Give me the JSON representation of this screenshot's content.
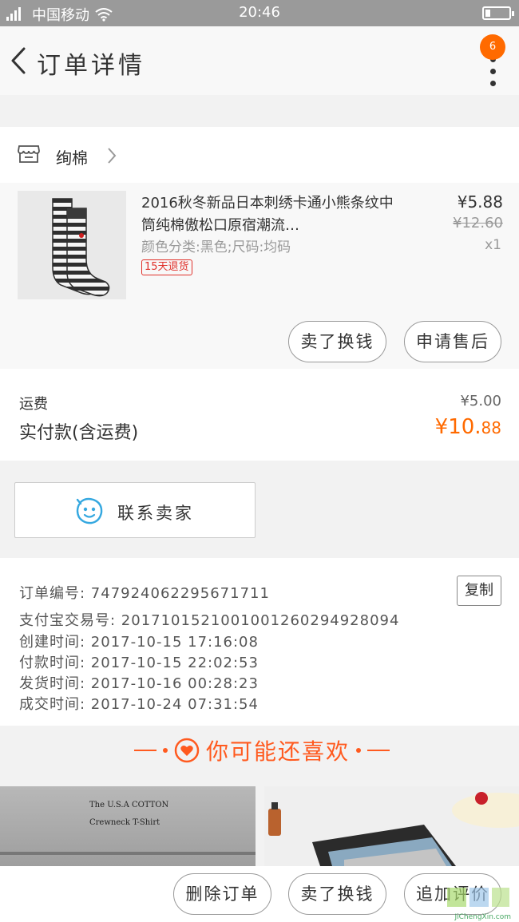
{
  "status_bar": {
    "carrier": "中国移动",
    "time": "20:46"
  },
  "nav": {
    "title": "订单详情",
    "badge_count": "6"
  },
  "shop": {
    "name": "绚棉"
  },
  "item": {
    "title": "2016秋冬新品日本刺绣卡通小熊条纹中筒纯棉傲松口原宿潮流…",
    "sku": "颜色分类:黑色;尺码:均码",
    "tag": "15天退货",
    "price": "¥5.88",
    "original_price": "¥12.60",
    "quantity": "x1",
    "actions": {
      "sell": "卖了换钱",
      "after_sale": "申请售后"
    }
  },
  "fees": {
    "shipping_label": "运费",
    "shipping_value": "¥5.00",
    "paid_label": "实付款(含运费)",
    "paid_symbol": "¥",
    "paid_int": "10.",
    "paid_dec": "88"
  },
  "contact": {
    "label": "联系卖家"
  },
  "order_info": {
    "order_no": "订单编号: 747924062295671711",
    "copy_label": "复制",
    "alipay_no": "支付宝交易号: 2017101521001001260294928094",
    "created": "创建时间: 2017-10-15 17:16:08",
    "paid": "付款时间: 2017-10-15 22:02:53",
    "shipped": "发货时间: 2017-10-16 00:28:23",
    "completed": "成交时间: 2017-10-24 07:31:54"
  },
  "recommend": {
    "title": "你可能还喜欢",
    "item1_line1": "The U.S.A COTTON",
    "item1_line2": "Crewneck T-Shirt"
  },
  "bottom_actions": {
    "delete": "删除订单",
    "sell": "卖了换钱",
    "review": "追加评价"
  },
  "watermark": {
    "url": "JiChengXin.com"
  },
  "colors": {
    "accent": "#ff6a00",
    "tag_red": "#e0312b",
    "status_bar": "#9a9a9a",
    "contact_blue": "#35a8e0"
  }
}
